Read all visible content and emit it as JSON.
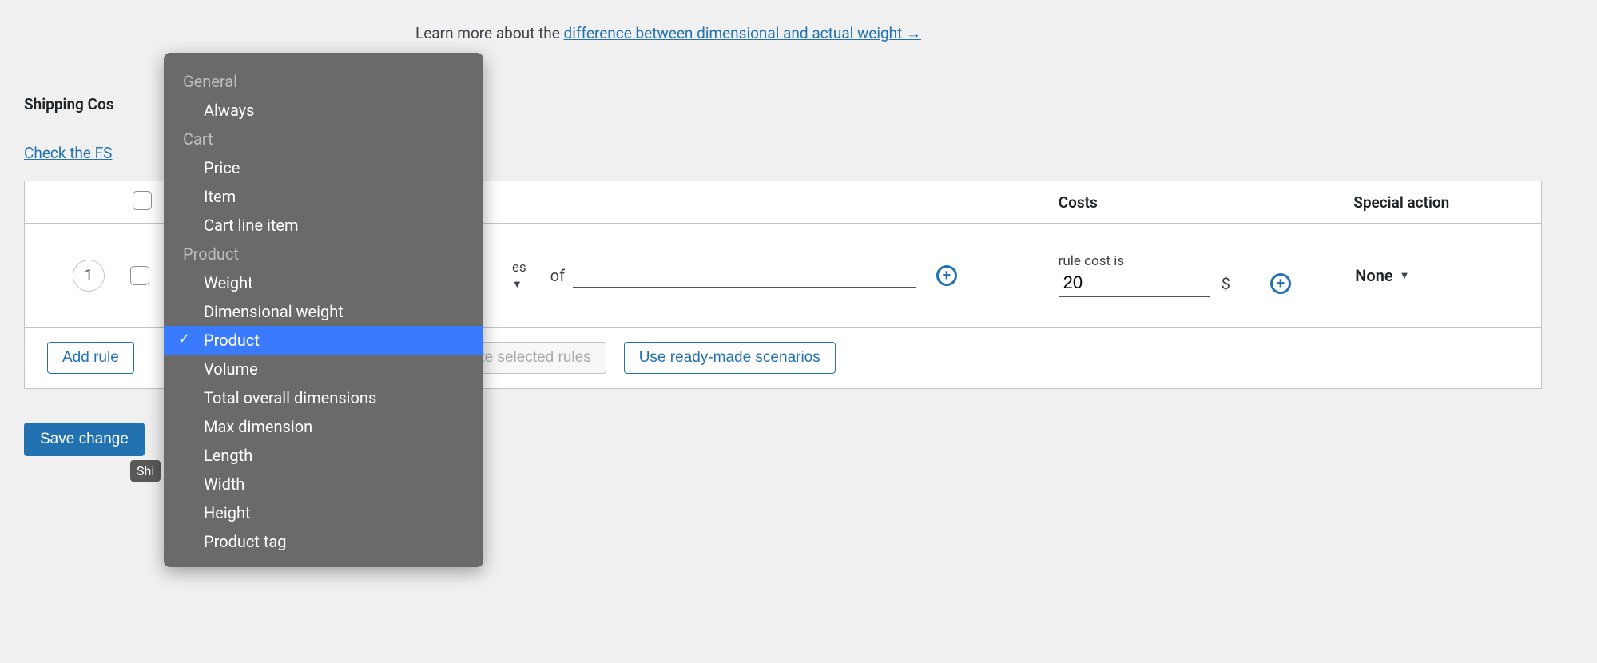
{
  "learn_more": {
    "prefix": "Learn more about the ",
    "link_text": "difference between dimensional and actual weight →"
  },
  "section_title": "Shipping Cos",
  "check_link": "Check the FS",
  "table": {
    "header_costs": "Costs",
    "header_action": "Special action"
  },
  "row": {
    "index": "1",
    "trailing_label": "es",
    "of_label": "of",
    "of_value": "",
    "cost_label": "rule cost is",
    "cost_value": "20",
    "currency": "$",
    "action_value": "None"
  },
  "tooltip_chip": "Shi",
  "footer": {
    "add_rule": "Add rule",
    "delete_selected": "ete selected rules",
    "use_scenarios": "Use ready-made scenarios"
  },
  "save_button": "Save change",
  "dropdown": {
    "groups": [
      {
        "label": "General",
        "items": [
          "Always"
        ]
      },
      {
        "label": "Cart",
        "items": [
          "Price",
          "Item",
          "Cart line item"
        ]
      },
      {
        "label": "Product",
        "items": [
          "Weight",
          "Dimensional weight",
          "Product",
          "Volume",
          "Total overall dimensions",
          "Max dimension",
          "Length",
          "Width",
          "Height",
          "Product tag"
        ]
      }
    ],
    "selected": "Product"
  }
}
